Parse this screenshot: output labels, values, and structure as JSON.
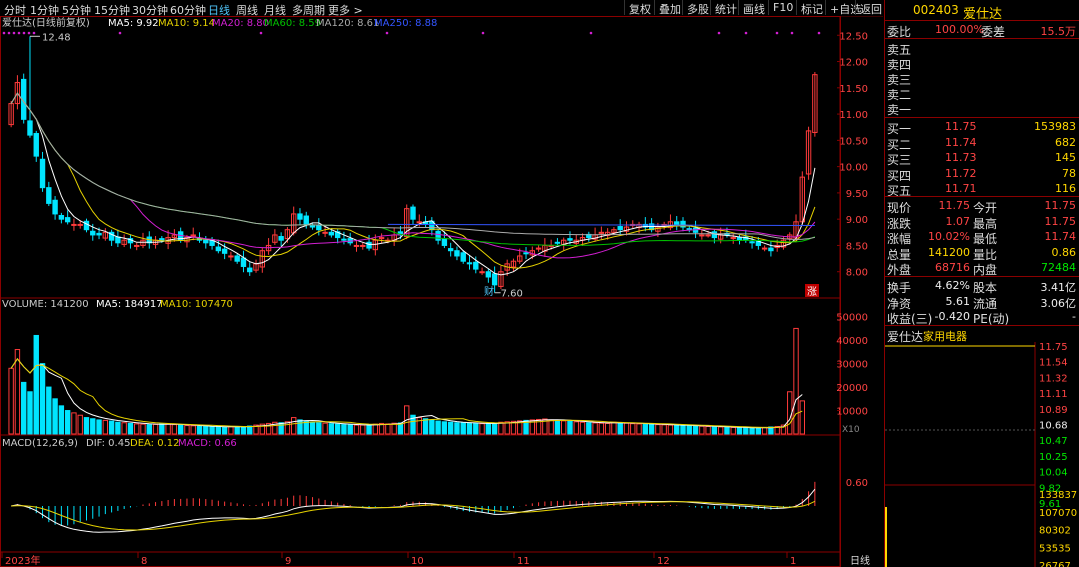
{
  "toolbar": {
    "periods": [
      "分时",
      "1分钟",
      "5分钟",
      "15分钟",
      "30分钟",
      "60分钟",
      "日线",
      "周线",
      "月线",
      "多周期",
      "更多 >"
    ],
    "active_period": "日线",
    "buttons": [
      "复权",
      "叠加",
      "多股",
      "统计",
      "画线",
      "F10",
      "标记",
      "+自选",
      "返回"
    ]
  },
  "main_legend": {
    "title": "爱仕达(日线前复权)",
    "ma5": "MA5: 9.92",
    "ma10": "MA10: 9.14",
    "ma20": "MA20: 8.80",
    "ma60": "MA60: 8.59",
    "ma120": "MA120: 8.61",
    "ma250": "MA250: 8.88"
  },
  "vol_legend": {
    "vol": "VOLUME: 141200",
    "ma5": "MA5: 184917",
    "ma10": "MA10: 107470"
  },
  "macd_legend": {
    "title": "MACD(12,26,9)",
    "dif": "DIF: 0.45",
    "dea": "DEA: 0.12",
    "macd": "MACD: 0.66"
  },
  "annotations": {
    "high": "12.48",
    "low": "7.60",
    "cai": "财",
    "zhang": "涨",
    "x10": "X10"
  },
  "x_axis": {
    "labels": [
      "2023年",
      "8",
      "9",
      "10",
      "11",
      "12",
      "1"
    ],
    "period_label": "日线"
  },
  "colors": {
    "up": "#ff3b3b",
    "down": "#00e5ff",
    "ma5": "#ffffff",
    "ma10": "#e6d200",
    "ma20": "#d21fd2",
    "ma60": "#00c000",
    "ma120": "#aaaaaa",
    "ma250": "#3355ff"
  },
  "chart_data": [
    {
      "type": "candlestick",
      "title": "爱仕达(日线前复权)",
      "y_ticks": [
        12.5,
        12.0,
        11.5,
        11.0,
        10.5,
        10.0,
        9.5,
        9.0,
        8.5,
        8.0
      ],
      "ylim": [
        7.5,
        12.6
      ],
      "close": [
        11.2,
        11.6,
        10.9,
        10.6,
        10.2,
        9.6,
        9.3,
        9.1,
        9.0,
        8.95,
        8.9,
        8.9,
        8.8,
        8.7,
        8.7,
        8.75,
        8.6,
        8.55,
        8.6,
        8.55,
        8.5,
        8.6,
        8.55,
        8.6,
        8.6,
        8.65,
        8.7,
        8.6,
        8.65,
        8.7,
        8.6,
        8.55,
        8.5,
        8.4,
        8.35,
        8.3,
        8.2,
        8.1,
        8.0,
        8.15,
        8.4,
        8.5,
        8.7,
        8.6,
        8.8,
        9.1,
        9.0,
        8.9,
        8.85,
        8.8,
        8.75,
        8.7,
        8.65,
        8.6,
        8.55,
        8.5,
        8.5,
        8.45,
        8.6,
        8.65,
        8.6,
        8.7,
        8.7,
        9.2,
        9.0,
        8.95,
        8.9,
        8.8,
        8.6,
        8.5,
        8.4,
        8.3,
        8.2,
        8.15,
        8.05,
        8.0,
        7.9,
        7.75,
        8.0,
        8.15,
        8.2,
        8.3,
        8.35,
        8.4,
        8.45,
        8.5,
        8.5,
        8.55,
        8.6,
        8.6,
        8.6,
        8.65,
        8.65,
        8.7,
        8.75,
        8.75,
        8.8,
        8.8,
        8.85,
        8.9,
        8.9,
        8.85,
        8.8,
        8.85,
        8.9,
        8.95,
        8.9,
        8.85,
        8.8,
        8.75,
        8.7,
        8.7,
        8.65,
        8.7,
        8.7,
        8.65,
        8.6,
        8.6,
        8.55,
        8.5,
        8.45,
        8.4,
        8.5,
        8.6,
        8.7,
        8.95,
        9.8,
        10.68,
        11.75
      ],
      "ma_last": {
        "MA5": 9.92,
        "MA10": 9.14,
        "MA20": 8.8,
        "MA60": 8.59,
        "MA120": 8.61,
        "MA250": 8.88
      }
    },
    {
      "type": "bar",
      "title": "VOLUME",
      "y_ticks": [
        50000,
        40000,
        30000,
        20000,
        10000
      ],
      "ylim": [
        0,
        52000
      ],
      "unit_marker": "X10",
      "values": [
        28000,
        36000,
        22000,
        18000,
        42000,
        30000,
        20000,
        15000,
        12000,
        10000,
        9000,
        8000,
        7000,
        6500,
        6000,
        5800,
        5500,
        5000,
        4800,
        4500,
        4300,
        4200,
        4000,
        4100,
        4200,
        4300,
        4000,
        3800,
        3600,
        3500,
        3300,
        3200,
        3100,
        3000,
        3000,
        3100,
        3200,
        3000,
        3400,
        3800,
        4200,
        4500,
        5000,
        4800,
        5200,
        7000,
        6000,
        5500,
        5000,
        4800,
        4600,
        4400,
        4200,
        4000,
        3900,
        3800,
        3800,
        3700,
        4200,
        4500,
        4300,
        4600,
        4700,
        12000,
        8000,
        7000,
        6500,
        6000,
        5500,
        5200,
        5000,
        4800,
        4700,
        4600,
        4500,
        4400,
        4300,
        4600,
        5000,
        5200,
        5400,
        5600,
        5800,
        6000,
        6200,
        6400,
        6000,
        5800,
        5600,
        5400,
        5200,
        5000,
        4800,
        4700,
        4600,
        4500,
        5000,
        4800,
        4600,
        4400,
        4300,
        4200,
        4100,
        4000,
        3900,
        3800,
        3700,
        3600,
        3500,
        3400,
        3300,
        3200,
        3100,
        3000,
        2900,
        2800,
        2700,
        2600,
        2500,
        2600,
        2800,
        3000,
        3200,
        3800,
        18000,
        45000,
        14120
      ]
    },
    {
      "type": "bar",
      "title": "MACD(12,26,9)",
      "y_ticks": [
        0.6
      ],
      "dif_last": 0.45,
      "dea_last": 0.12,
      "macd_last": 0.66
    }
  ],
  "quote": {
    "code": "002403",
    "name": "爱仕达",
    "webi_label": "委比",
    "webi_value": "100.00%",
    "weicha_label": "委差",
    "weicha_value": "15.5万",
    "sell": [
      {
        "label": "卖五",
        "price": "",
        "vol": ""
      },
      {
        "label": "卖四",
        "price": "",
        "vol": ""
      },
      {
        "label": "卖三",
        "price": "",
        "vol": ""
      },
      {
        "label": "卖二",
        "price": "",
        "vol": ""
      },
      {
        "label": "卖一",
        "price": "",
        "vol": ""
      }
    ],
    "buy": [
      {
        "label": "买一",
        "price": "11.75",
        "vol": "153983"
      },
      {
        "label": "买二",
        "price": "11.74",
        "vol": "682"
      },
      {
        "label": "买三",
        "price": "11.73",
        "vol": "145"
      },
      {
        "label": "买四",
        "price": "11.72",
        "vol": "78"
      },
      {
        "label": "买五",
        "price": "11.71",
        "vol": "116"
      }
    ],
    "stats": [
      {
        "l1": "现价",
        "v1": "11.75",
        "l2": "今开",
        "v2": "11.75",
        "c1": "red",
        "c2": "red"
      },
      {
        "l1": "涨跌",
        "v1": "1.07",
        "l2": "最高",
        "v2": "11.75",
        "c1": "red",
        "c2": "red"
      },
      {
        "l1": "涨幅",
        "v1": "10.02%",
        "l2": "最低",
        "v2": "11.74",
        "c1": "red",
        "c2": "red"
      },
      {
        "l1": "总量",
        "v1": "141200",
        "l2": "量比",
        "v2": "0.86",
        "c1": "yel",
        "c2": "yel"
      },
      {
        "l1": "外盘",
        "v1": "68716",
        "l2": "内盘",
        "v2": "72484",
        "c1": "red",
        "c2": "grn"
      }
    ],
    "stats2": [
      {
        "l1": "换手",
        "v1": "4.62%",
        "l2": "股本",
        "v2": "3.41亿"
      },
      {
        "l1": "净资",
        "v1": "5.61",
        "l2": "流通",
        "v2": "3.06亿"
      },
      {
        "l1": "收益(三)",
        "v1": "-0.420",
        "l2": "PE(动)",
        "v2": "-"
      }
    ],
    "industry_name": "爱仕达",
    "industry": "家用电器"
  },
  "mini_chart": {
    "y_labels": [
      "11.75",
      "11.54",
      "11.32",
      "11.11",
      "10.89",
      "10.68",
      "10.47",
      "10.25",
      "10.04",
      "9.82",
      "9.61"
    ],
    "vol_labels": [
      "133837",
      "107070",
      "80302",
      "53535",
      "26767"
    ]
  }
}
